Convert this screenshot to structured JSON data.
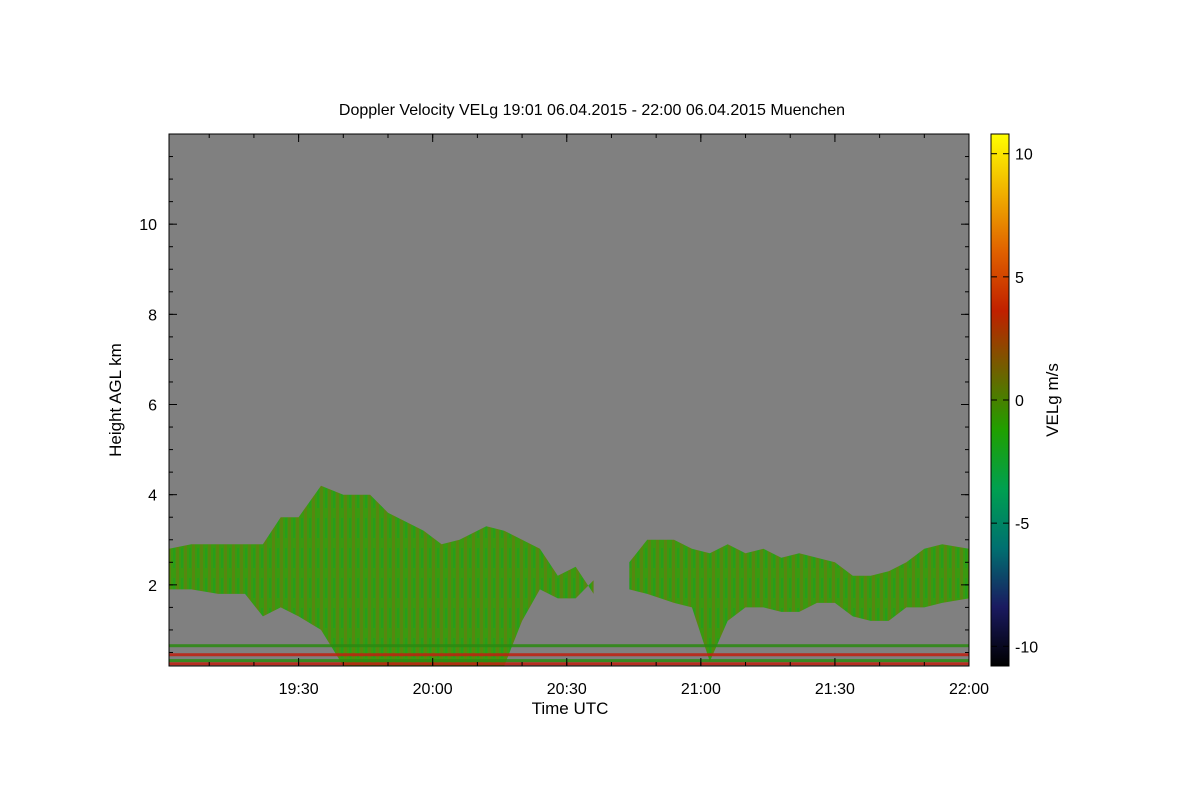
{
  "chart_data": {
    "type": "heatmap",
    "title": "Doppler Velocity VELg   19:01 06.04.2015 - 22:00 06.04.2015 Muenchen",
    "xlabel": "Time UTC",
    "ylabel": "Height AGL km",
    "colorbar_label": "VELg m/s",
    "x_tick_labels": [
      "19:30",
      "20:00",
      "20:30",
      "21:00",
      "21:30",
      "22:00"
    ],
    "x_tick_values_min": [
      1170,
      1200,
      1230,
      1260,
      1290,
      1320
    ],
    "xlim_min": [
      1141,
      1320
    ],
    "y_tick_labels": [
      "2",
      "4",
      "6",
      "8",
      "10"
    ],
    "y_tick_values": [
      2,
      4,
      6,
      8,
      10
    ],
    "ylim": [
      0.2,
      12.0
    ],
    "colorbar_tick_labels": [
      "10",
      "5",
      "0",
      "-5",
      "-10"
    ],
    "colorbar_tick_values": [
      10,
      5,
      0,
      -5,
      -10
    ],
    "clim": [
      -10.8,
      10.8
    ],
    "background_color": "#808080",
    "colormap": [
      "#000000",
      "#1a1a60",
      "#007070",
      "#00a050",
      "#20a000",
      "#706000",
      "#c02000",
      "#e06000",
      "#f0b000",
      "#ffff00"
    ],
    "cloud_envelope_km": {
      "time_min": [
        1141,
        1146,
        1152,
        1158,
        1162,
        1166,
        1170,
        1175,
        1180,
        1186,
        1190,
        1194,
        1198,
        1202,
        1206,
        1212,
        1216,
        1220,
        1224,
        1228,
        1232,
        1236,
        1240,
        1244,
        1248,
        1254,
        1258,
        1262,
        1266,
        1270,
        1274,
        1278,
        1282,
        1286,
        1290,
        1294,
        1298,
        1302,
        1306,
        1310,
        1314,
        1320
      ],
      "top_km": [
        2.8,
        2.9,
        2.9,
        2.9,
        2.9,
        3.5,
        3.5,
        4.2,
        4.0,
        4.0,
        3.6,
        3.4,
        3.2,
        2.9,
        3.0,
        3.3,
        3.2,
        3.0,
        2.8,
        2.2,
        2.4,
        1.8,
        null,
        2.5,
        3.0,
        3.0,
        2.8,
        2.7,
        2.9,
        2.7,
        2.8,
        2.6,
        2.7,
        2.6,
        2.5,
        2.2,
        2.2,
        2.3,
        2.5,
        2.8,
        2.9,
        2.8
      ],
      "base_km": [
        1.9,
        1.9,
        1.8,
        1.8,
        1.3,
        1.5,
        1.3,
        1.0,
        0.2,
        0.2,
        0.2,
        0.2,
        0.2,
        0.2,
        0.2,
        0.2,
        0.2,
        1.2,
        1.9,
        1.7,
        1.7,
        2.1,
        null,
        1.9,
        1.8,
        1.6,
        1.5,
        0.3,
        1.2,
        1.5,
        1.5,
        1.4,
        1.4,
        1.6,
        1.6,
        1.3,
        1.2,
        1.2,
        1.5,
        1.5,
        1.6,
        1.7
      ]
    },
    "near_ground_layers_km": [
      0.25,
      0.32,
      0.45,
      0.65
    ],
    "grid": false,
    "legend": "colorbar-right"
  }
}
